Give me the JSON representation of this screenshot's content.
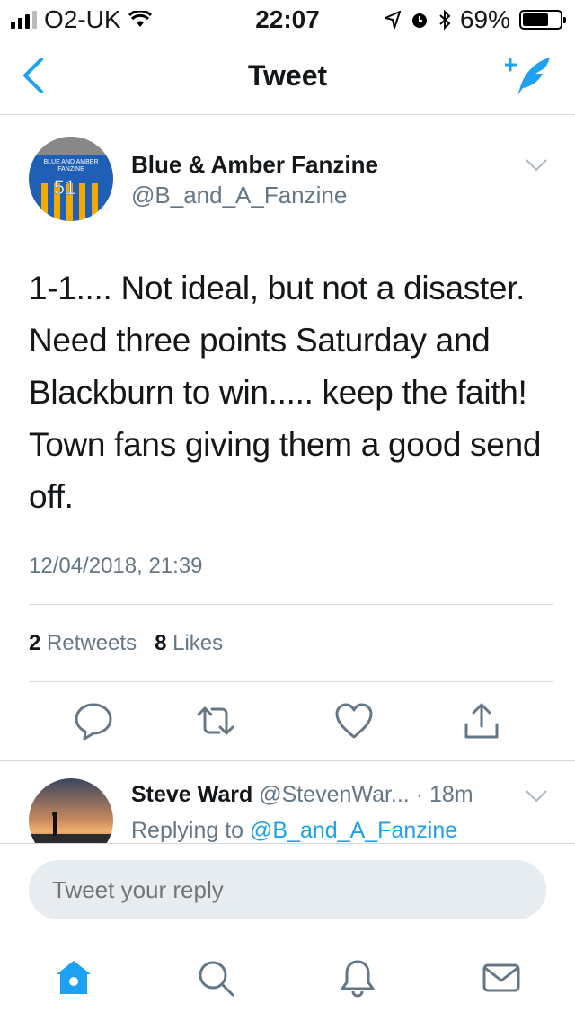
{
  "status_bar": {
    "carrier": "O2-UK",
    "time": "22:07",
    "battery": "69%",
    "battery_level": 0.69
  },
  "nav": {
    "title": "Tweet",
    "back_icon": "chevron-left-icon",
    "compose_icon": "compose-tweet-icon"
  },
  "tweet": {
    "author_name": "Blue & Amber Fanzine",
    "author_handle": "@B_and_A_Fanzine",
    "text": "1-1.... Not ideal, but not a disaster. Need three points Saturday and Blackburn to win..... keep the faith! Town fans giving them a good send off.",
    "timestamp": "12/04/2018, 21:39",
    "retweets_count": "2",
    "retweets_label": "Retweets",
    "likes_count": "8",
    "likes_label": "Likes",
    "avatar_text": {
      "line1": "BLUE AND AMBER",
      "line2": "FANZINE",
      "number": "51"
    }
  },
  "reply_preview": {
    "name": "Steve Ward",
    "handle": "@StevenWar...",
    "time": "· 18m",
    "replying_prefix": "Replying to",
    "replying_handle": "@B_and_A_Fanzine"
  },
  "reply_bar": {
    "placeholder": "Tweet your reply"
  },
  "colors": {
    "accent": "#1da1f2",
    "secondary_text": "#657786",
    "icon_gray": "#657786"
  }
}
